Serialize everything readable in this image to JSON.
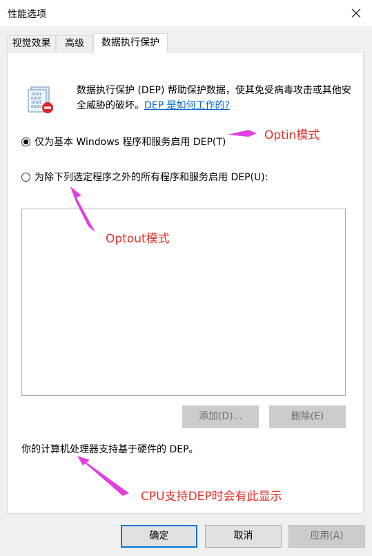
{
  "window": {
    "title": "性能选项"
  },
  "tabs": [
    {
      "label": "视觉效果"
    },
    {
      "label": "高级"
    },
    {
      "label": "数据执行保护"
    }
  ],
  "dep": {
    "description": "数据执行保护 (DEP) 帮助保护数据，使其免受病毒攻击或其他安全威胁的破坏。",
    "link": "DEP 是如何工作的?",
    "option_optin": "仅为基本 Windows 程序和服务启用 DEP(T)",
    "option_optout": "为除下列选定程序之外的所有程序和服务启用 DEP(U):",
    "add_label": "添加(D)...",
    "remove_label": "删除(E)",
    "cpu_support": "你的计算机处理器支持基于硬件的 DEP。"
  },
  "annotations": {
    "optin": "Optin模式",
    "optout": "Optout模式",
    "cpu": "CPU支持DEP时会有此显示",
    "color": "#e5312a",
    "arrow_color": "#e040e0"
  },
  "footer": {
    "ok": "确定",
    "cancel": "取消",
    "apply": "应用(A)"
  },
  "state": {
    "selected_option": "optin",
    "active_tab": "数据执行保护"
  }
}
